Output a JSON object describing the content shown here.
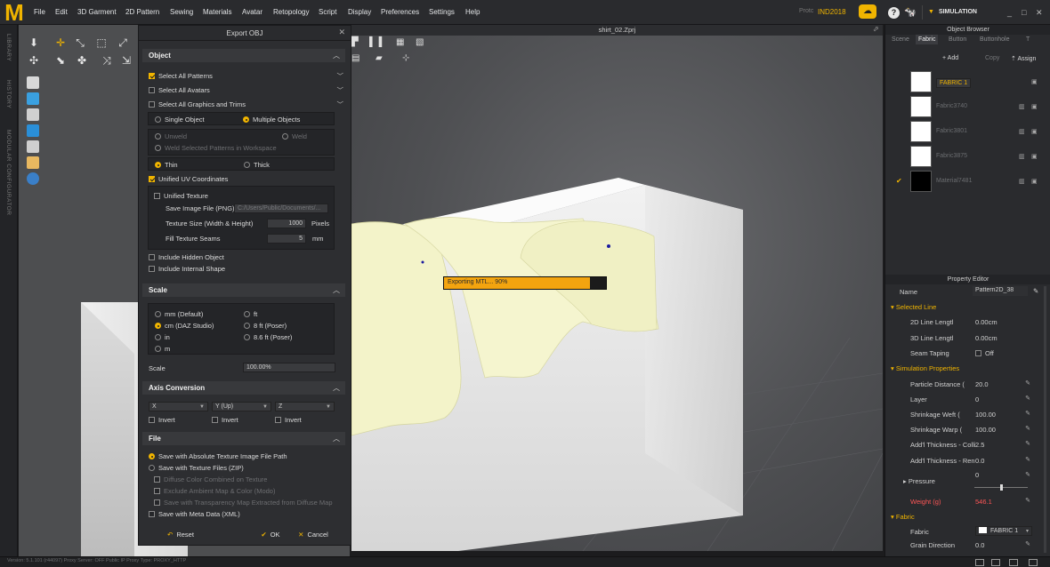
{
  "app": {
    "logo": "M",
    "menus": [
      "File",
      "Edit",
      "3D Garment",
      "2D Pattern",
      "Sewing",
      "Materials",
      "Avatar",
      "Retopology",
      "Script",
      "Display",
      "Preferences",
      "Settings",
      "Help"
    ],
    "user_label": "Protc",
    "user_name": "IND2018",
    "mode": "SIMULATION",
    "window_controls": [
      "_",
      "□",
      "✕"
    ]
  },
  "left_tabs": [
    "LIBRARY",
    "HISTORY",
    "MODULAR CONFIGURATOR"
  ],
  "dialog": {
    "title": "Export OBJ",
    "sections": {
      "object": {
        "title": "Object",
        "select_all_patterns": "Select All Patterns",
        "select_all_avatars": "Select All Avatars",
        "select_all_graphics": "Select All Graphics and Trims",
        "single_object": "Single Object",
        "multiple_objects": "Multiple Objects",
        "unweld": "Unweld",
        "weld": "Weld",
        "weld_selected": "Weld Selected Patterns in Workspace",
        "thin": "Thin",
        "thick": "Thick",
        "unified_uv": "Unified UV Coordinates",
        "unified_texture": "Unified Texture",
        "save_image_file": "Save Image File (PNG)",
        "save_image_value": "C:/Users/Public/Documents/...",
        "texture_size": "Texture Size (Width & Height)",
        "texture_size_value": "1000",
        "texture_size_unit": "Pixels",
        "fill_seams": "Fill Texture Seams",
        "fill_seams_value": "5",
        "fill_seams_unit": "mm",
        "include_hidden": "Include Hidden Object",
        "include_internal": "Include Internal Shape"
      },
      "scale": {
        "title": "Scale",
        "options_left": [
          "mm (Default)",
          "cm (DAZ Studio)",
          "in",
          "m"
        ],
        "options_right": [
          "ft",
          "8 ft (Poser)",
          "8.6 ft (Poser)"
        ],
        "scale_label": "Scale",
        "scale_value": "100.00%"
      },
      "axis": {
        "title": "Axis Conversion",
        "x": "X",
        "y": "Y (Up)",
        "z": "Z",
        "invert": "Invert"
      },
      "file": {
        "title": "File",
        "absolute_path": "Save with Absolute Texture Image File Path",
        "texture_zip": "Save with Texture Files (ZIP)",
        "diffuse_combined": "Diffuse Color Combined on Texture",
        "exclude_ambient": "Exclude Ambient Map & Color (Modo)",
        "transparency_map": "Save with Transparency Map Extracted from Diffuse Map",
        "meta_data": "Save with Meta Data (XML)"
      }
    },
    "buttons": {
      "reset": "Reset",
      "ok": "OK",
      "cancel": "Cancel"
    }
  },
  "viewport": {
    "title": "shirt_02.Zprj",
    "progress_text": "Exporting MTL... 90%",
    "progress": 0.9
  },
  "object_browser": {
    "title": "Object Browser",
    "tabs": [
      "Scene",
      "Fabric",
      "Button",
      "Buttonhole",
      "T"
    ],
    "add_label": "+ Add",
    "copy_label": "Copy",
    "assign_label": "Assign",
    "fabrics": [
      {
        "name": "FABRIC 1",
        "color": "#ffffff",
        "selected": true,
        "check": ""
      },
      {
        "name": "Fabric3740",
        "color": "#ffffff",
        "selected": false,
        "check": ""
      },
      {
        "name": "Fabric3801",
        "color": "#ffffff",
        "selected": false,
        "check": ""
      },
      {
        "name": "Fabric3875",
        "color": "#ffffff",
        "selected": false,
        "check": ""
      },
      {
        "name": "Material7481",
        "color": "#000000",
        "selected": false,
        "check": "✔"
      }
    ]
  },
  "property_editor": {
    "title": "Property Editor",
    "name_label": "Name",
    "name_value": "Pattern2D_38",
    "selected_line": "Selected Line",
    "line_length_2d": "2D Line Lengtl",
    "line_length_2d_value": "0.00cm",
    "line_length_3d": "3D Line Lengtl",
    "line_length_3d_value": "0.00cm",
    "seam_taping": "Seam Taping",
    "seam_taping_value": "Off",
    "sim_props": "Simulation Properties",
    "particle_distance": "Particle Distance (",
    "particle_distance_value": "20.0",
    "layer": "Layer",
    "layer_value": "0",
    "shrink_weft": "Shrinkage Weft (",
    "shrink_weft_value": "100.00",
    "shrink_warp": "Shrinkage Warp (",
    "shrink_warp_value": "100.00",
    "add_thick_coll": "Add'l Thickness - Colli",
    "add_thick_coll_value": "2.5",
    "add_thick_ren": "Add'l Thickness - Ren",
    "add_thick_ren_value": "0.0",
    "pressure": "Pressure",
    "pressure_value": "0",
    "weight": "Weight (g)",
    "weight_value": "546.1",
    "fabric_section": "Fabric",
    "fabric_label": "Fabric",
    "fabric_value": "FABRIC 1",
    "grain_direction": "Grain Direction",
    "grain_direction_value": "0.0"
  },
  "status_bar": {
    "text": "Version: 5.1.101 (r44097)     Proxy Server: OFF   Public IP     Proxy Type: PROXY_HTTP"
  }
}
